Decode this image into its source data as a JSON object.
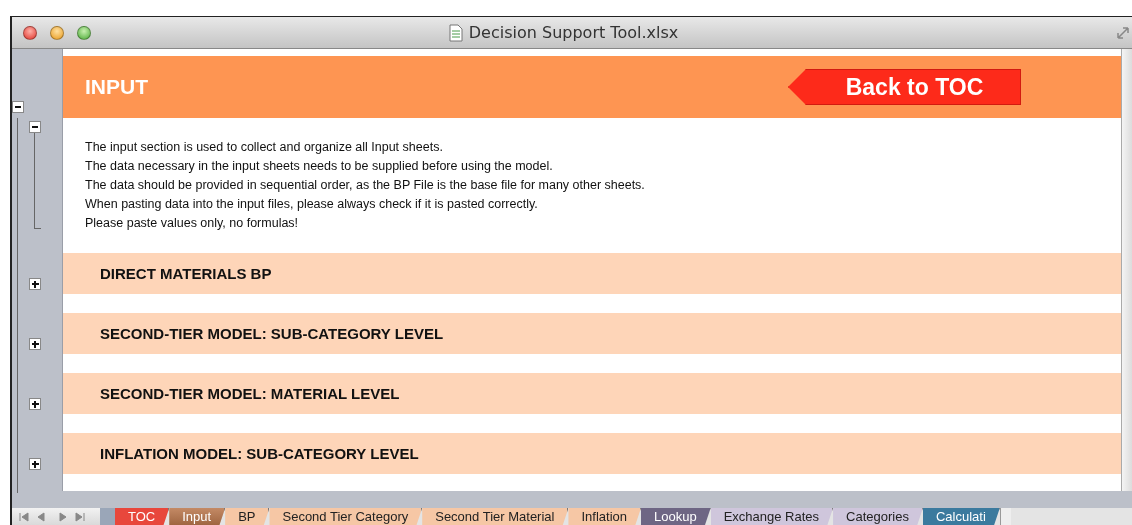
{
  "window": {
    "title": "Decision Support Tool.xlsx"
  },
  "header": {
    "title": "INPUT",
    "button": "Back to TOC"
  },
  "outline": {
    "expanded": true
  },
  "intro": {
    "expanded": true,
    "lines": [
      "The input section is used to collect and organize all Input sheets.",
      "The data necessary in the input sheets needs to be supplied before using the model.",
      "The data should be provided in sequential order, as the BP File is the base file for many other sheets.",
      "When pasting data into the input files, please always check if it is pasted correctly.",
      "Please paste values only, no formulas!"
    ]
  },
  "sections": [
    {
      "title": "DIRECT MATERIALS BP",
      "expanded": false
    },
    {
      "title": "SECOND-TIER MODEL: SUB-CATEGORY LEVEL",
      "expanded": false
    },
    {
      "title": "SECOND-TIER MODEL: MATERIAL LEVEL",
      "expanded": false
    },
    {
      "title": "INFLATION MODEL: SUB-CATEGORY LEVEL",
      "expanded": false
    }
  ],
  "sheet_tabs": [
    {
      "label": "TOC",
      "color": "#e8473c",
      "selected": false
    },
    {
      "label": "Input",
      "color": "#b9754a",
      "selected": true
    },
    {
      "label": "BP",
      "color": "#f6c7a5",
      "selected": false
    },
    {
      "label": "Second Tier Category",
      "color": "#f6c7a5",
      "selected": false
    },
    {
      "label": "Second Tier Material",
      "color": "#f6c7a5",
      "selected": false
    },
    {
      "label": "Inflation",
      "color": "#f6c7a5",
      "selected": false
    },
    {
      "label": "Lookup",
      "color": "#6e6684",
      "selected": false
    },
    {
      "label": "Exchange Rates",
      "color": "#cfc6dc",
      "selected": false
    },
    {
      "label": "Categories",
      "color": "#cfc6dc",
      "selected": false
    },
    {
      "label": "Calculati",
      "color": "#3b7a9e",
      "selected": false
    }
  ]
}
